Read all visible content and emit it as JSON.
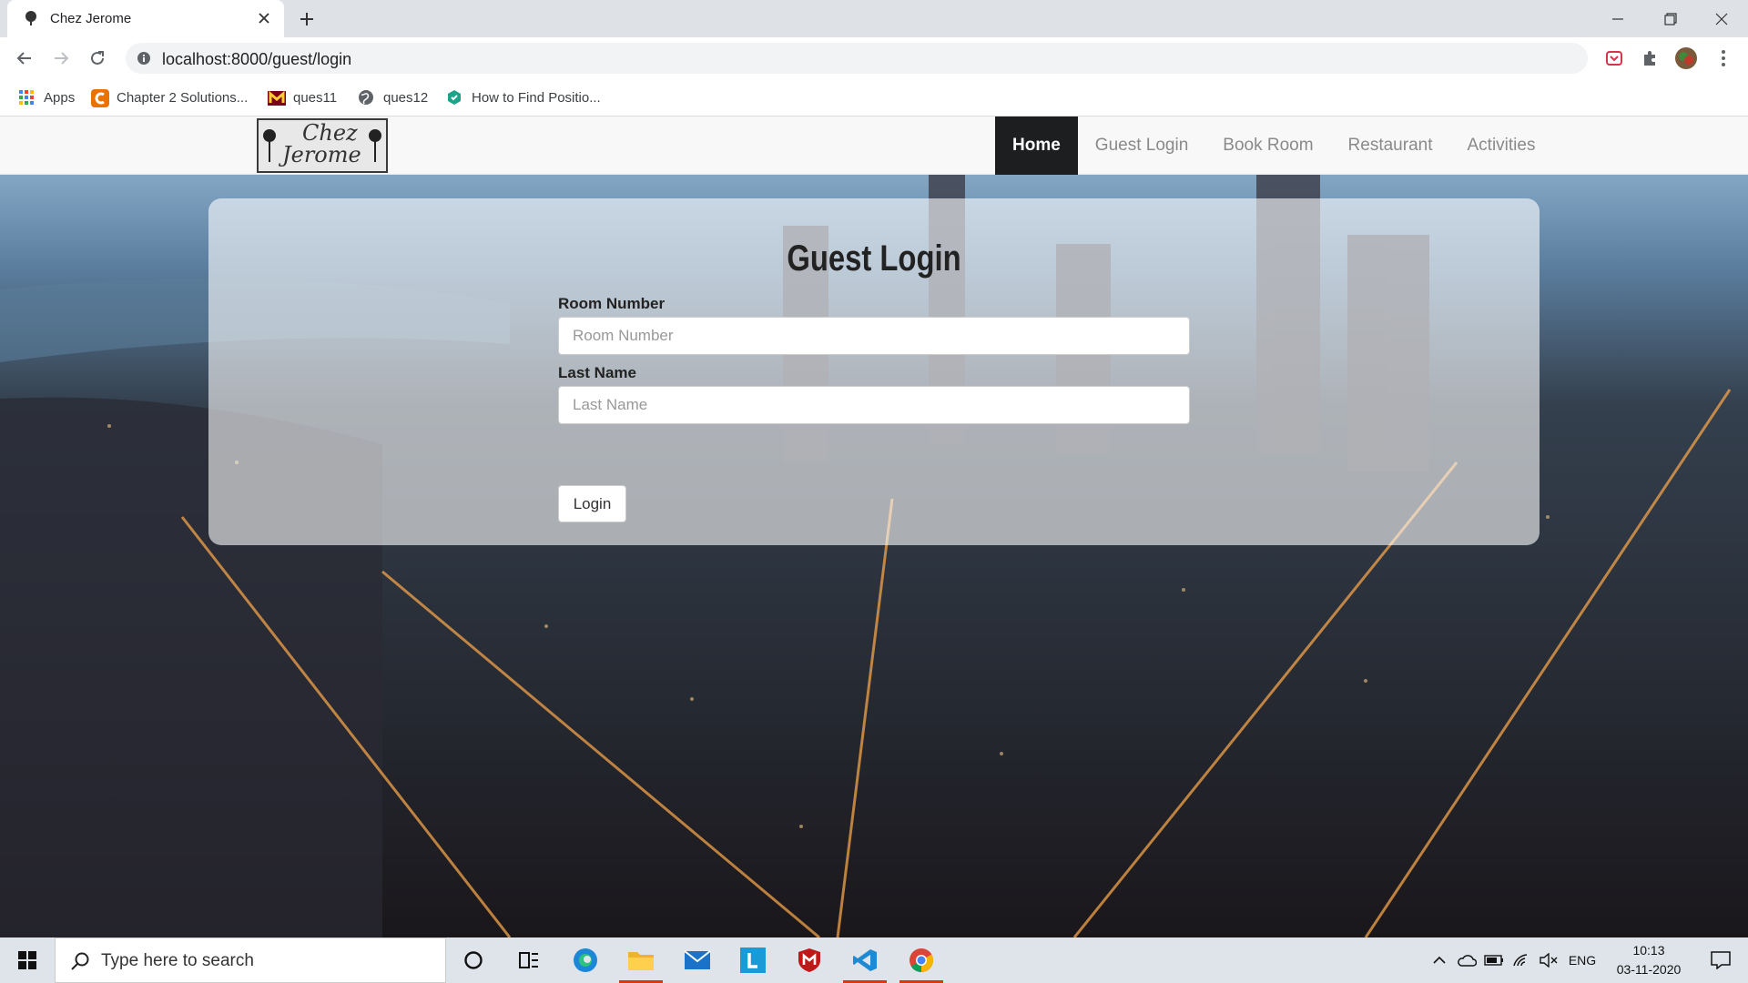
{
  "browser": {
    "tab_title": "Chez Jerome",
    "url": "localhost:8000/guest/login",
    "bookmarks": [
      {
        "label": "Apps",
        "icon": "apps-grid-icon"
      },
      {
        "label": "Chapter 2 Solutions...",
        "icon": "chegg-icon"
      },
      {
        "label": "ques11",
        "icon": "umn-icon"
      },
      {
        "label": "ques12",
        "icon": "globe-icon"
      },
      {
        "label": "How to Find Positio...",
        "icon": "hexagon-icon"
      }
    ]
  },
  "site": {
    "brand": {
      "line1": "Chez",
      "line2": "Jerome"
    },
    "nav": [
      {
        "label": "Home",
        "active": true
      },
      {
        "label": "Guest Login",
        "active": false
      },
      {
        "label": "Book Room",
        "active": false
      },
      {
        "label": "Restaurant",
        "active": false
      },
      {
        "label": "Activities",
        "active": false
      }
    ]
  },
  "login": {
    "title": "Guest Login",
    "room_label": "Room Number",
    "room_placeholder": "Room Number",
    "room_value": "",
    "lastname_label": "Last Name",
    "lastname_placeholder": "Last Name",
    "lastname_value": "",
    "button": "Login"
  },
  "taskbar": {
    "search_placeholder": "Type here to search",
    "lang": "ENG",
    "time": "10:13",
    "date": "03-11-2020"
  },
  "colors": {
    "nav_active_bg": "#1d1e20",
    "nav_text": "#8a8a8a",
    "taskbar_bg": "#dfe4ea"
  }
}
